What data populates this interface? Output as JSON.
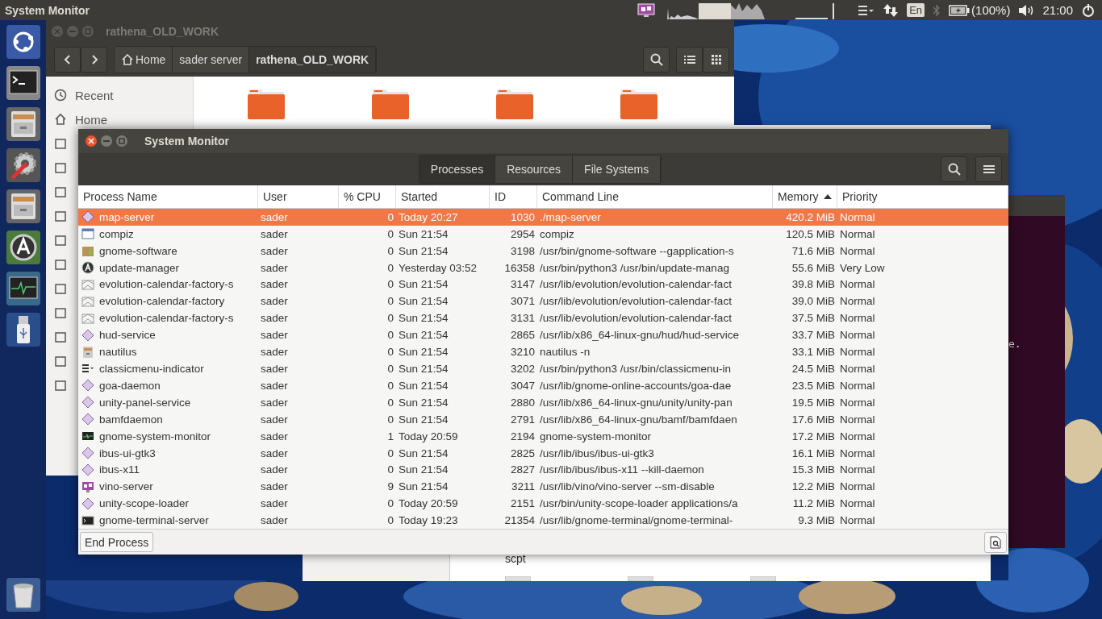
{
  "top_panel": {
    "app_title": "System Monitor",
    "language": "En",
    "battery": "(100%)",
    "clock": "21:00"
  },
  "launcher": [
    {
      "kind": "ubuntu"
    },
    {
      "kind": "terminal"
    },
    {
      "kind": "files"
    },
    {
      "kind": "settings"
    },
    {
      "kind": "files"
    },
    {
      "kind": "updater"
    },
    {
      "kind": "monitor"
    },
    {
      "kind": "usb"
    }
  ],
  "trash": {
    "kind": "trash"
  },
  "file_manager": {
    "title": "rathena_OLD_WORK",
    "breadcrumbs": [
      {
        "label": "Home",
        "selected": false
      },
      {
        "label": "sader server",
        "selected": false
      },
      {
        "label": "rathena_OLD_WORK",
        "selected": true
      }
    ],
    "sidebar": [
      {
        "label": "Recent",
        "kind": "clock"
      },
      {
        "label": "Home",
        "kind": "home"
      }
    ]
  },
  "back_window": {
    "file_label": "scpt"
  },
  "terminal_window": {
    "text": "e."
  },
  "system_monitor": {
    "title": "System Monitor",
    "tabs": [
      {
        "label": "Processes",
        "selected": true
      },
      {
        "label": "Resources",
        "selected": false
      },
      {
        "label": "File Systems",
        "selected": false
      }
    ],
    "columns": [
      {
        "label": "Process Name",
        "sorted": false
      },
      {
        "label": "User",
        "sorted": false
      },
      {
        "label": "% CPU",
        "sorted": false
      },
      {
        "label": "Started",
        "sorted": false
      },
      {
        "label": "ID",
        "sorted": false
      },
      {
        "label": "Command Line",
        "sorted": false
      },
      {
        "label": "Memory",
        "sorted": true
      },
      {
        "label": "Priority",
        "sorted": false
      }
    ],
    "rows": [
      {
        "kind": "diamond",
        "name": "map-server",
        "user": "sader",
        "cpu": "0",
        "started": "Today 20:27",
        "id": "1030",
        "command": "./map-server",
        "memory": "420.2 MiB",
        "priority": "Normal",
        "selected": true
      },
      {
        "kind": "window",
        "name": "compiz",
        "user": "sader",
        "cpu": "0",
        "started": "Sun 21:54",
        "id": "2954",
        "command": "compiz",
        "memory": "120.5 MiB",
        "priority": "Normal",
        "selected": false
      },
      {
        "kind": "package",
        "name": "gnome-software",
        "user": "sader",
        "cpu": "0",
        "started": "Sun 21:54",
        "id": "3198",
        "command": "/usr/bin/gnome-software --gapplication-s",
        "memory": "71.6 MiB",
        "priority": "Normal",
        "selected": false
      },
      {
        "kind": "updater",
        "name": "update-manager",
        "user": "sader",
        "cpu": "0",
        "started": "Yesterday 03:52",
        "id": "16358",
        "command": "/usr/bin/python3 /usr/bin/update-manag",
        "memory": "55.6 MiB",
        "priority": "Very Low",
        "selected": false
      },
      {
        "kind": "envelope",
        "name": "evolution-calendar-factory-s",
        "user": "sader",
        "cpu": "0",
        "started": "Sun 21:54",
        "id": "3147",
        "command": "/usr/lib/evolution/evolution-calendar-fact",
        "memory": "39.8 MiB",
        "priority": "Normal",
        "selected": false
      },
      {
        "kind": "envelope",
        "name": "evolution-calendar-factory",
        "user": "sader",
        "cpu": "0",
        "started": "Sun 21:54",
        "id": "3071",
        "command": "/usr/lib/evolution/evolution-calendar-fact",
        "memory": "39.0 MiB",
        "priority": "Normal",
        "selected": false
      },
      {
        "kind": "envelope",
        "name": "evolution-calendar-factory-s",
        "user": "sader",
        "cpu": "0",
        "started": "Sun 21:54",
        "id": "3131",
        "command": "/usr/lib/evolution/evolution-calendar-fact",
        "memory": "37.5 MiB",
        "priority": "Normal",
        "selected": false
      },
      {
        "kind": "diamond",
        "name": "hud-service",
        "user": "sader",
        "cpu": "0",
        "started": "Sun 21:54",
        "id": "2865",
        "command": "/usr/lib/x86_64-linux-gnu/hud/hud-service",
        "memory": "33.7 MiB",
        "priority": "Normal",
        "selected": false
      },
      {
        "kind": "files",
        "name": "nautilus",
        "user": "sader",
        "cpu": "0",
        "started": "Sun 21:54",
        "id": "3210",
        "command": "nautilus -n",
        "memory": "33.1 MiB",
        "priority": "Normal",
        "selected": false
      },
      {
        "kind": "menu",
        "name": "classicmenu-indicator",
        "user": "sader",
        "cpu": "0",
        "started": "Sun 21:54",
        "id": "3202",
        "command": "/usr/bin/python3 /usr/bin/classicmenu-in",
        "memory": "24.5 MiB",
        "priority": "Normal",
        "selected": false
      },
      {
        "kind": "diamond",
        "name": "goa-daemon",
        "user": "sader",
        "cpu": "0",
        "started": "Sun 21:54",
        "id": "3047",
        "command": "/usr/lib/gnome-online-accounts/goa-dae",
        "memory": "23.5 MiB",
        "priority": "Normal",
        "selected": false
      },
      {
        "kind": "diamond",
        "name": "unity-panel-service",
        "user": "sader",
        "cpu": "0",
        "started": "Sun 21:54",
        "id": "2880",
        "command": "/usr/lib/x86_64-linux-gnu/unity/unity-pan",
        "memory": "19.5 MiB",
        "priority": "Normal",
        "selected": false
      },
      {
        "kind": "diamond",
        "name": "bamfdaemon",
        "user": "sader",
        "cpu": "0",
        "started": "Sun 21:54",
        "id": "2791",
        "command": "/usr/lib/x86_64-linux-gnu/bamf/bamfdaen",
        "memory": "17.6 MiB",
        "priority": "Normal",
        "selected": false
      },
      {
        "kind": "monitor",
        "name": "gnome-system-monitor",
        "user": "sader",
        "cpu": "1",
        "started": "Today 20:59",
        "id": "2194",
        "command": "gnome-system-monitor",
        "memory": "17.2 MiB",
        "priority": "Normal",
        "selected": false
      },
      {
        "kind": "diamond",
        "name": "ibus-ui-gtk3",
        "user": "sader",
        "cpu": "0",
        "started": "Sun 21:54",
        "id": "2825",
        "command": "/usr/lib/ibus/ibus-ui-gtk3",
        "memory": "16.1 MiB",
        "priority": "Normal",
        "selected": false
      },
      {
        "kind": "diamond",
        "name": "ibus-x11",
        "user": "sader",
        "cpu": "0",
        "started": "Sun 21:54",
        "id": "2827",
        "command": "/usr/lib/ibus/ibus-x11 --kill-daemon",
        "memory": "15.3 MiB",
        "priority": "Normal",
        "selected": false
      },
      {
        "kind": "vino",
        "name": "vino-server",
        "user": "sader",
        "cpu": "9",
        "started": "Sun 21:54",
        "id": "3211",
        "command": "/usr/lib/vino/vino-server --sm-disable",
        "memory": "12.2 MiB",
        "priority": "Normal",
        "selected": false
      },
      {
        "kind": "diamond",
        "name": "unity-scope-loader",
        "user": "sader",
        "cpu": "0",
        "started": "Today 20:59",
        "id": "2151",
        "command": "/usr/bin/unity-scope-loader applications/a",
        "memory": "11.2 MiB",
        "priority": "Normal",
        "selected": false
      },
      {
        "kind": "terminal",
        "name": "gnome-terminal-server",
        "user": "sader",
        "cpu": "0",
        "started": "Today 19:23",
        "id": "21354",
        "command": "/usr/lib/gnome-terminal/gnome-terminal-",
        "memory": "9.3 MiB",
        "priority": "Normal",
        "selected": false
      }
    ],
    "end_button": "End Process"
  }
}
